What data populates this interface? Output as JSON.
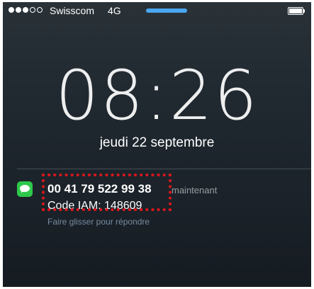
{
  "status_bar": {
    "signal_full": 3,
    "signal_empty": 2,
    "carrier": "Swisscom",
    "network": "4G",
    "loading_color": "#4aa6ef"
  },
  "lock_screen": {
    "time": "08:26",
    "date": "jeudi 22 septembre"
  },
  "notification": {
    "app_icon": "messages-icon",
    "app_color": "#2ec84a",
    "sender": "00 41 79 522 99 38",
    "time_label": "maintenant",
    "message": "Code IAM: 148609",
    "slide_hint": "Faire glisser pour répondre"
  },
  "annotation": {
    "highlight_color": "#e0161b"
  }
}
